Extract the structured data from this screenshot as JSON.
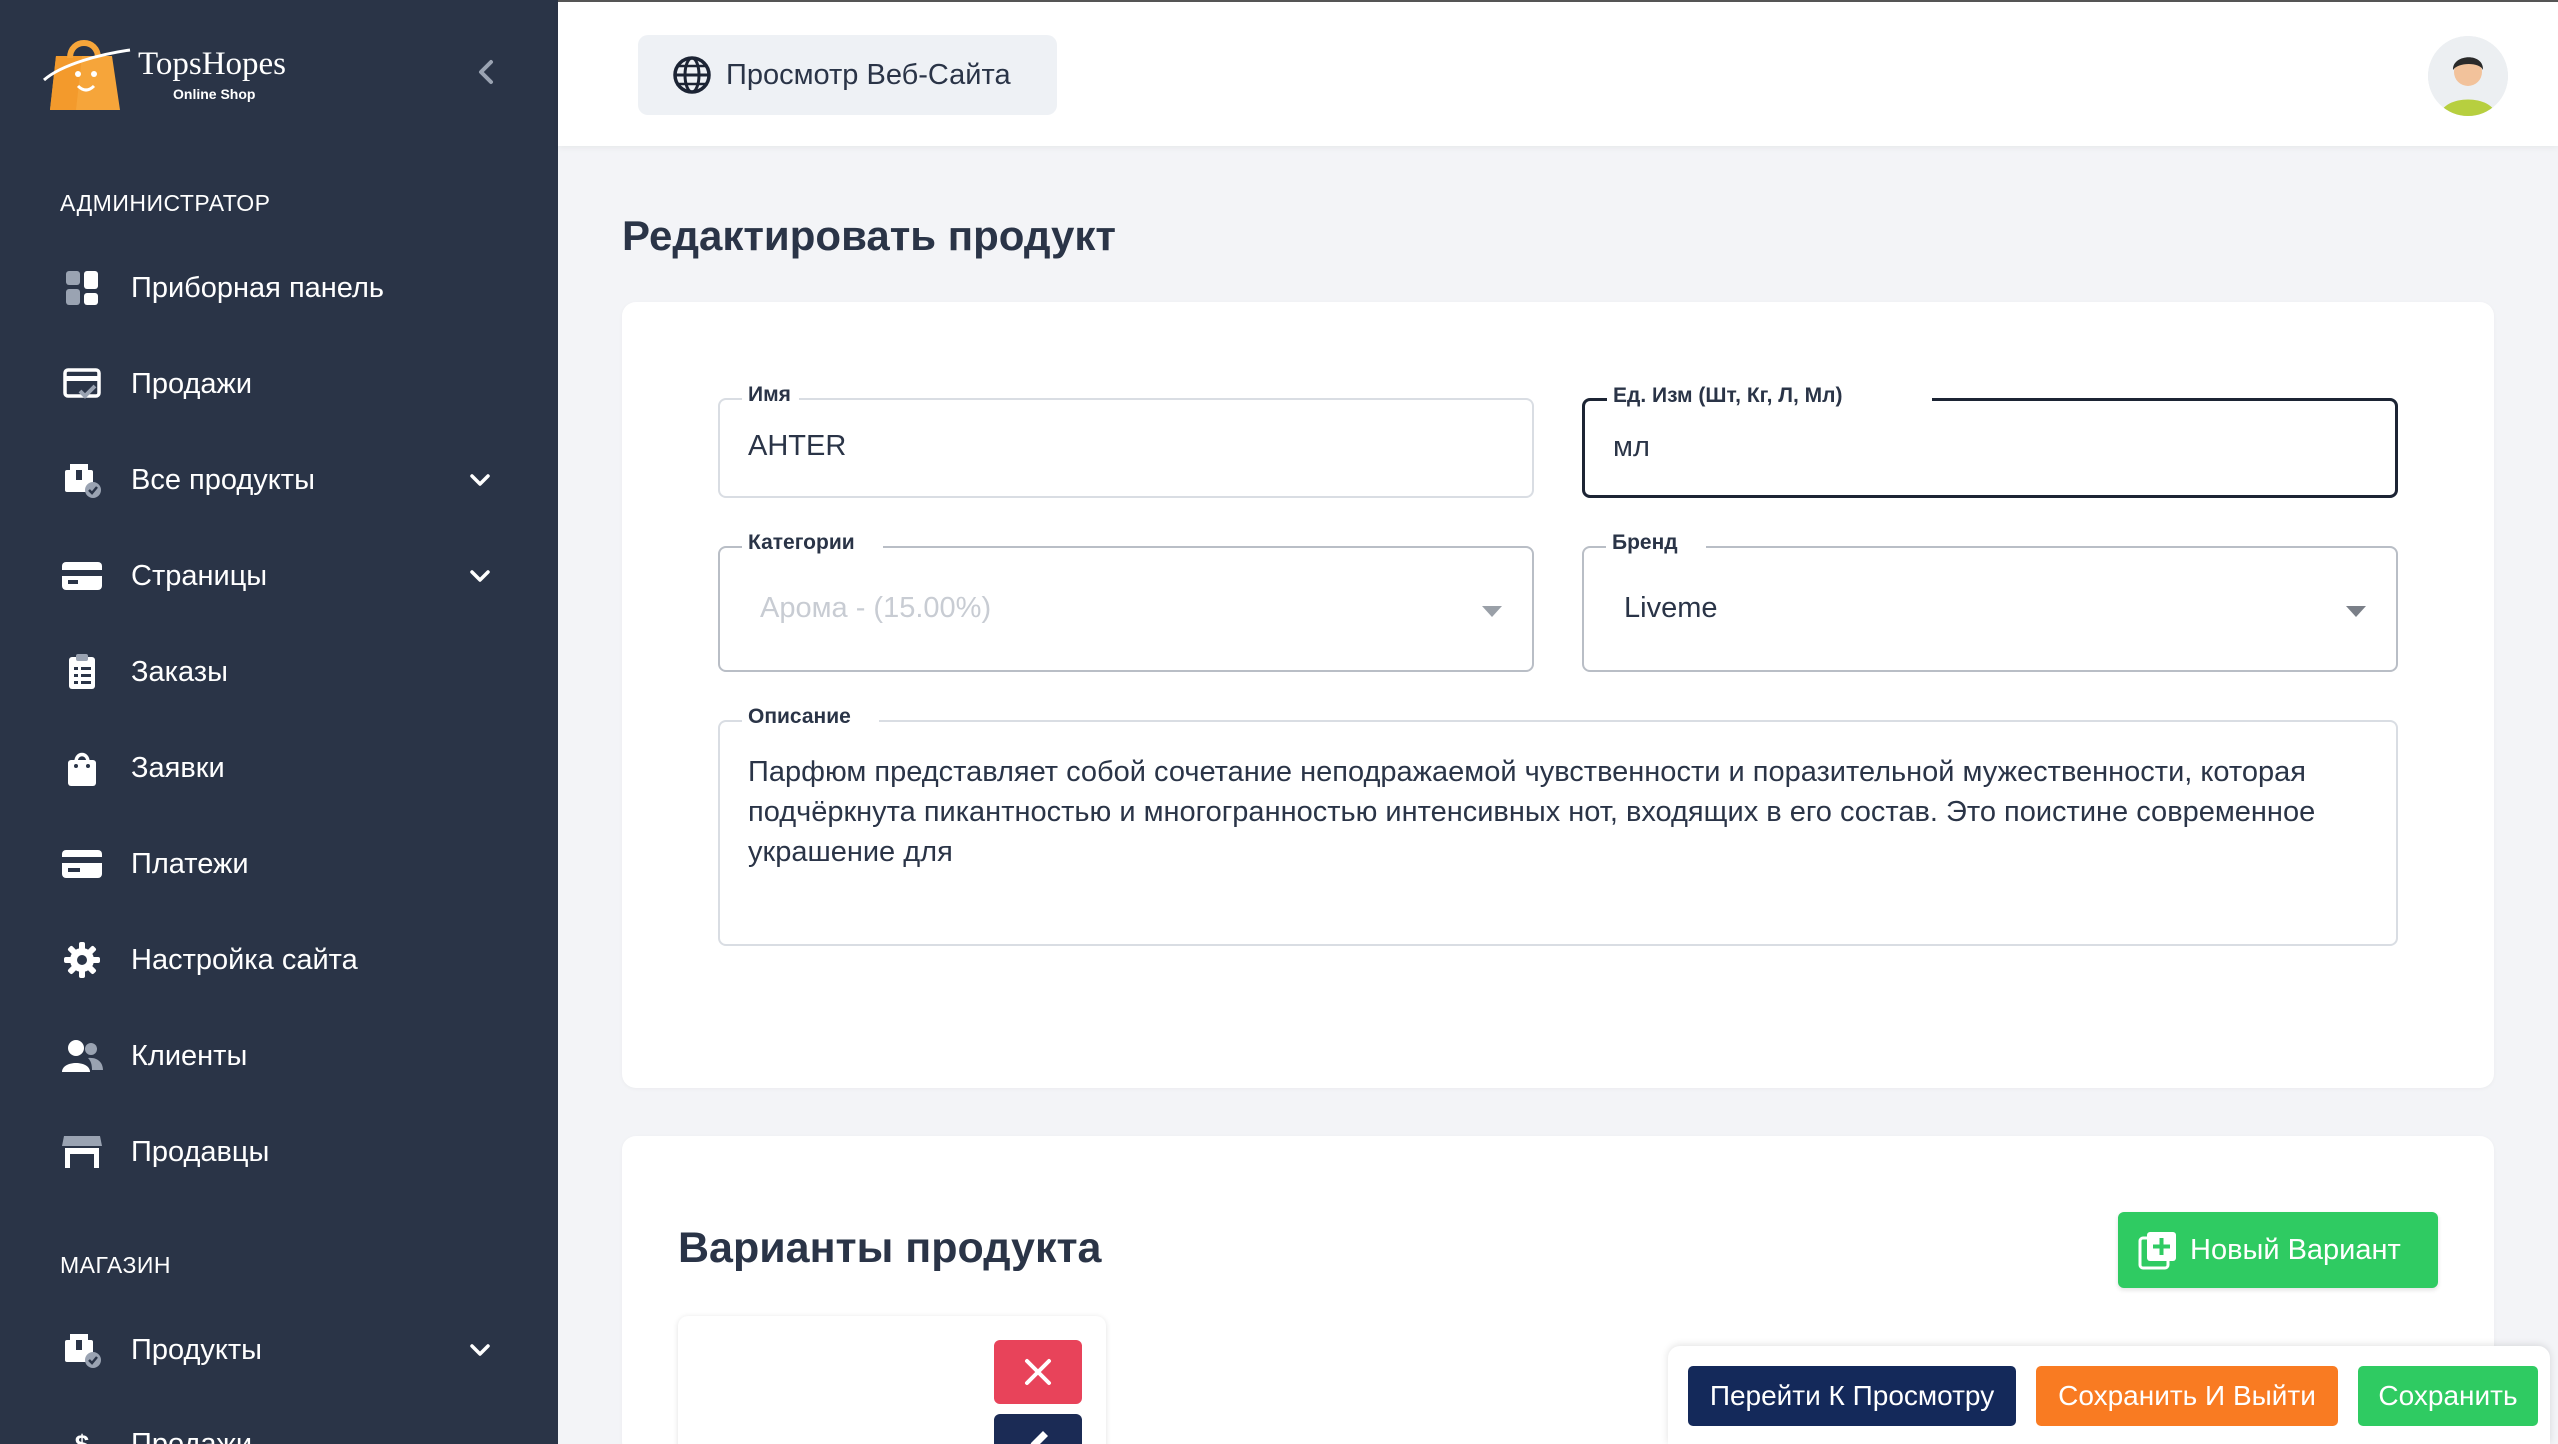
{
  "app": {
    "brand_name": "TopsHopes",
    "brand_tagline": "Online Shop"
  },
  "sidebar": {
    "section_admin": "АДМИНИСТРАТОР",
    "section_shop": "МАГАЗИН",
    "items": [
      {
        "label": "Приборная панель",
        "icon": "dashboard-icon",
        "expandable": false
      },
      {
        "label": "Продажи",
        "icon": "sales-icon",
        "expandable": false
      },
      {
        "label": "Все продукты",
        "icon": "products-icon",
        "expandable": true
      },
      {
        "label": "Страницы",
        "icon": "pages-icon",
        "expandable": true
      },
      {
        "label": "Заказы",
        "icon": "orders-icon",
        "expandable": false
      },
      {
        "label": "Заявки",
        "icon": "requests-icon",
        "expandable": false
      },
      {
        "label": "Платежи",
        "icon": "payments-icon",
        "expandable": false
      },
      {
        "label": "Настройка сайта",
        "icon": "gear-icon",
        "expandable": false
      },
      {
        "label": "Клиенты",
        "icon": "clients-icon",
        "expandable": false
      },
      {
        "label": "Продавцы",
        "icon": "store-icon",
        "expandable": false
      }
    ],
    "shop_items": [
      {
        "label": "Продукты",
        "icon": "products-icon",
        "expandable": true
      },
      {
        "label": "Продажи",
        "icon": "dollar-icon",
        "expandable": false
      }
    ]
  },
  "topbar": {
    "view_site_label": "Просмотр Веб-Сайта"
  },
  "page": {
    "title": "Редактировать продукт"
  },
  "form": {
    "name": {
      "label": "Имя",
      "value": "AHTER"
    },
    "unit": {
      "label": "Ед. Изм (Шт, Кг, Л, Мл)",
      "value": "мл"
    },
    "category": {
      "label": "Категории",
      "value": "Арома - (15.00%)"
    },
    "brand": {
      "label": "Бренд",
      "value": "Liveme"
    },
    "description": {
      "label": "Описание",
      "value": "Парфюм представляет собой сочетание неподражаемой чувственности и поразительной мужественности, которая подчёркнута пикантностью и многогранностью интенсивных нот, входящих в его состав. Это поистине современное украшение для"
    }
  },
  "variants": {
    "title": "Варианты продукта",
    "new_button": "Новый Вариант"
  },
  "actions": {
    "preview": "Перейти К Просмотру",
    "save_exit": "Сохранить И Выйти",
    "save": "Сохранить"
  },
  "colors": {
    "sidebar_bg": "#2a3447",
    "accent_green": "#2fcb62",
    "accent_orange": "#f97b22",
    "accent_navy": "#14295a",
    "danger": "#e8435a"
  }
}
